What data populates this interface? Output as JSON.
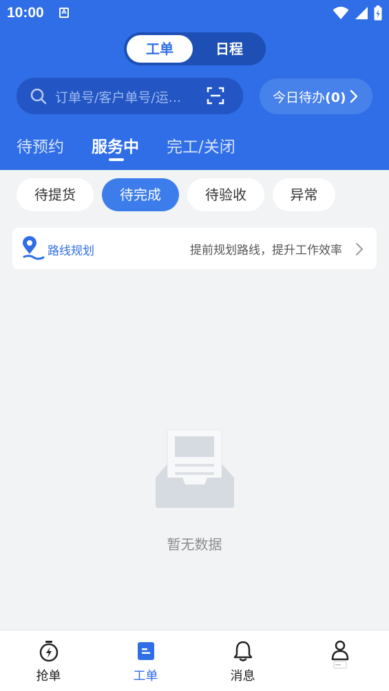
{
  "status_bar": {
    "time": "10:00",
    "notif_icon_letter": "A"
  },
  "segment": {
    "items": [
      "工单",
      "日程"
    ],
    "active": "工单"
  },
  "search": {
    "placeholder": "订单号/客户单号/运..."
  },
  "todo": {
    "label": "今日待办",
    "count": "(0)"
  },
  "tabs": [
    {
      "label": "待预约",
      "active": false
    },
    {
      "label": "服务中",
      "active": true
    },
    {
      "label": "完工/关闭",
      "active": false
    }
  ],
  "chips": [
    {
      "label": "待提货",
      "active": false
    },
    {
      "label": "待完成",
      "active": true
    },
    {
      "label": "待验收",
      "active": false
    },
    {
      "label": "异常",
      "active": false
    }
  ],
  "route": {
    "title": "路线规划",
    "description": "提前规划路线，提升工作效率",
    "icon": "route-pin-icon"
  },
  "empty": {
    "text": "暂无数据"
  },
  "bottom_nav": [
    {
      "label": "抢单",
      "icon": "grab-order-icon",
      "active": false
    },
    {
      "label": "工单",
      "icon": "work-order-icon",
      "active": true
    },
    {
      "label": "消息",
      "icon": "bell-icon",
      "active": false
    },
    {
      "label": "",
      "icon": "profile-icon",
      "active": false
    }
  ],
  "colors": {
    "primary": "#2f6ee6",
    "chip_active": "#3c7deb",
    "background": "#f2f3f5"
  }
}
